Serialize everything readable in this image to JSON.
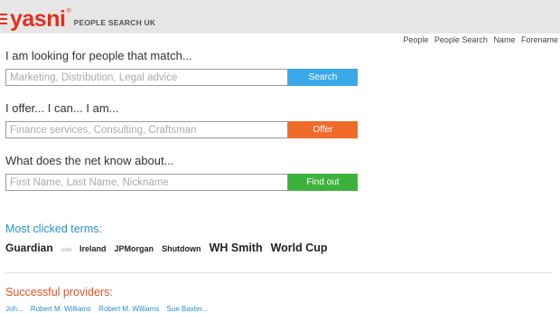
{
  "brand": {
    "name": "yasni",
    "registered": "®",
    "tagline": "PEOPLE SEARCH UK",
    "color": "#e2301c"
  },
  "top_links": [
    "People",
    "People Search",
    "Name",
    "Forename"
  ],
  "forms": [
    {
      "label": "I am looking for people that match...",
      "placeholder": "Marketing, Distribution, Legal advice",
      "value": "",
      "button": "Search",
      "button_color": "#3aa8e8"
    },
    {
      "label": "I offer... I can... I am...",
      "placeholder": "Finance services, Consulting, Craftsman",
      "value": "",
      "button": "Offer",
      "button_color": "#f06a2a"
    },
    {
      "label": "What does the net know about...",
      "placeholder": "First Name, Last Name, Nickname",
      "value": "",
      "button": "Find out",
      "button_color": "#3cb23a"
    }
  ],
  "most_clicked": {
    "heading": "Most clicked terms:",
    "terms": [
      "Guardian",
      "Intel",
      "Ireland",
      "JPMorgan",
      "Shutdown",
      "WH Smith",
      "World Cup"
    ]
  },
  "providers": {
    "heading": "Successful providers:",
    "items": [
      "Joh...",
      "Robert M. Williams",
      "Robert M. Williams",
      "Sue Baxter..."
    ]
  }
}
